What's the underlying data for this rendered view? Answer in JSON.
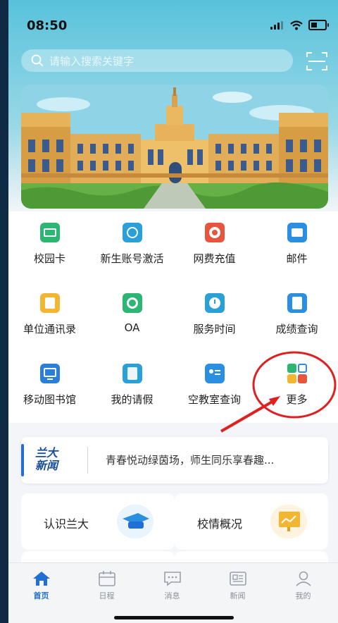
{
  "status_bar": {
    "time": "08:50"
  },
  "search": {
    "placeholder": "请输入搜索关键字"
  },
  "grid": {
    "items": [
      {
        "label": "校园卡",
        "icon": "campus-card-icon",
        "color": "#2bb673"
      },
      {
        "label": "新生账号激活",
        "icon": "account-activation-icon",
        "color": "#2aa0d8"
      },
      {
        "label": "网费充值",
        "icon": "network-fee-icon",
        "color": "#e8553d"
      },
      {
        "label": "邮件",
        "icon": "mail-icon",
        "color": "#2a8fe0"
      },
      {
        "label": "单位通讯录",
        "icon": "directory-icon",
        "color": "#f2b632"
      },
      {
        "label": "OA",
        "icon": "oa-icon",
        "color": "#2bb673"
      },
      {
        "label": "服务时间",
        "icon": "service-time-icon",
        "color": "#2aa0d8"
      },
      {
        "label": "成绩查询",
        "icon": "grades-icon",
        "color": "#2a8fe0"
      },
      {
        "label": "移动图书馆",
        "icon": "library-icon",
        "color": "#2a7fd8"
      },
      {
        "label": "我的请假",
        "icon": "leave-request-icon",
        "color": "#2aa0d8"
      },
      {
        "label": "空教室查询",
        "icon": "empty-classroom-icon",
        "color": "#2a8fe0"
      },
      {
        "label": "更多",
        "icon": "more-apps-icon",
        "color": "#2bb673"
      }
    ]
  },
  "news": {
    "logo_line1": "兰大",
    "logo_line2": "新闻",
    "headline": "青春悦动绿茵场，师生同乐享春趣..."
  },
  "cards": [
    {
      "title": "认识兰大",
      "icon": "graduation-cap-icon"
    },
    {
      "title": "校情概况",
      "icon": "presentation-board-icon"
    }
  ],
  "tabbar": [
    {
      "label": "首页",
      "icon": "home-icon",
      "active": true
    },
    {
      "label": "日程",
      "icon": "calendar-icon",
      "active": false
    },
    {
      "label": "消息",
      "icon": "message-icon",
      "active": false
    },
    {
      "label": "新闻",
      "icon": "news-icon",
      "active": false
    },
    {
      "label": "我的",
      "icon": "profile-icon",
      "active": false
    }
  ],
  "colors": {
    "accent": "#1f6fd6",
    "annotation": "#e02020"
  }
}
